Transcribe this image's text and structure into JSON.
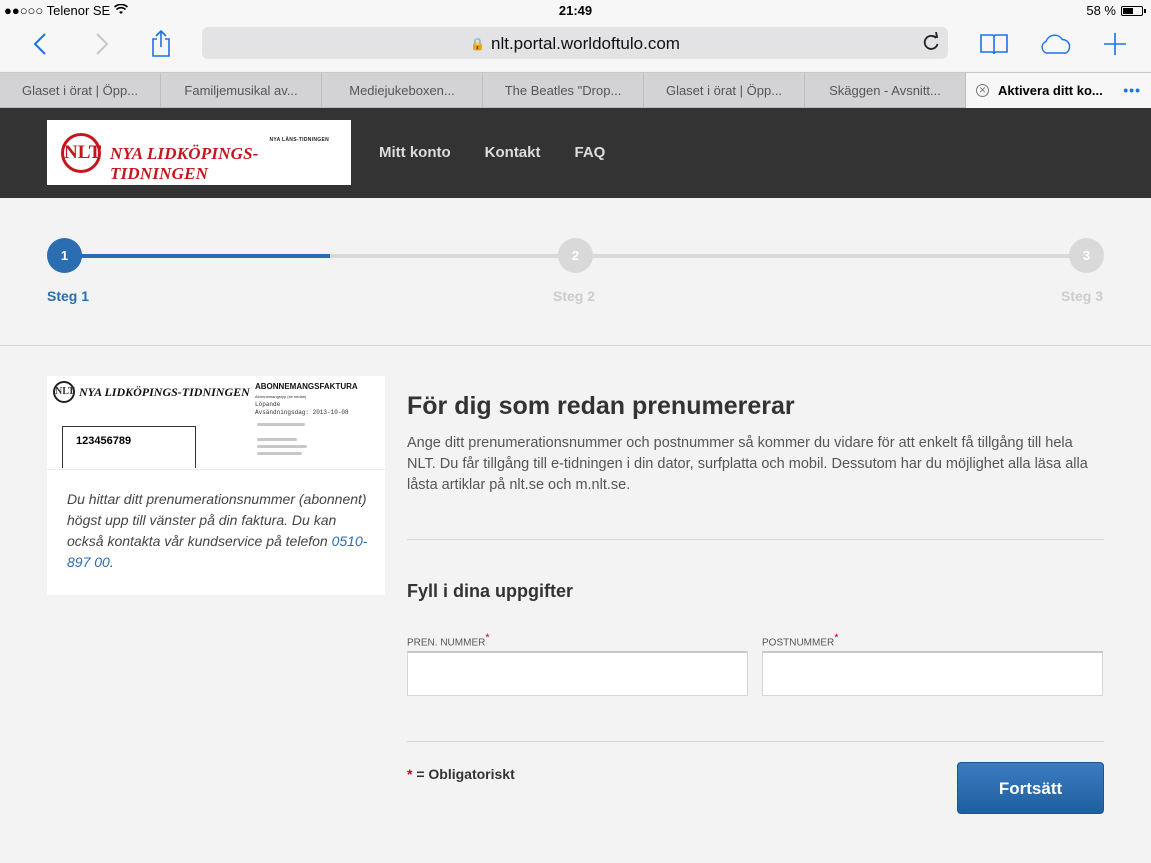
{
  "status_bar": {
    "carrier": "●●○○○ Telenor SE",
    "time": "21:49",
    "battery_text": "58 %",
    "battery_level": 0.58
  },
  "browser": {
    "url": "nlt.portal.worldoftulo.com",
    "tabs": [
      {
        "label": "Glaset i örat | Öpp..."
      },
      {
        "label": "Familjemusikal av..."
      },
      {
        "label": "Mediejukeboxen..."
      },
      {
        "label": "The Beatles \"Drop..."
      },
      {
        "label": "Glaset i örat | Öpp..."
      },
      {
        "label": "Skäggen - Avsnitt..."
      },
      {
        "label": "Aktivera ditt ko..."
      }
    ],
    "active_tab_more": "•••"
  },
  "site": {
    "logo": {
      "mark": "NLT",
      "name": "NYA LIDKÖPINGS-TIDNINGEN",
      "sub": "NYA LÄNS-TIDNINGEN"
    },
    "nav": [
      "Mitt konto",
      "Kontakt",
      "FAQ"
    ]
  },
  "progress": {
    "fill_fraction": 0.26,
    "steps": [
      {
        "number": "1",
        "label": "Steg 1",
        "active": true
      },
      {
        "number": "2",
        "label": "Steg 2",
        "active": false
      },
      {
        "number": "3",
        "label": "Steg 3",
        "active": false
      }
    ]
  },
  "invoice": {
    "logo_mark": "NLT",
    "logo_name": "NYA LIDKÖPINGS-TIDNINGEN",
    "title": "ABONNEMANGSFAKTURA",
    "meta_1": "Abonnemangstyp (se nedan)",
    "meta_2": "Löpande",
    "meta_3": "Avsändningsdag: 2013-10-08",
    "number": "123456789"
  },
  "info": {
    "text": "Du hittar ditt prenumerationsnummer (abonnent) högst upp till vänster på din faktura. Du kan också kontakta vår kundservice på telefon ",
    "phone": "0510-897 00",
    "end": "."
  },
  "main": {
    "title": "För dig som redan prenumererar",
    "intro": "Ange ditt prenumerationsnummer och postnummer så kommer du vidare för att enkelt få tillgång till hela NLT. Du får tillgång till e-tidningen i din dator, surfplatta och mobil. Dessutom har du möjlighet alla läsa alla låsta artiklar på nlt.se och m.nlt.se.",
    "form_title": "Fyll i dina uppgifter",
    "fields": [
      {
        "label": "PREN. NUMMER",
        "required_mark": "*",
        "value": ""
      },
      {
        "label": "POSTNUMMER",
        "required_mark": "*",
        "value": ""
      }
    ],
    "legend_mark": "*",
    "legend_text": " = Obligatoriskt",
    "submit_label": "Fortsätt"
  }
}
